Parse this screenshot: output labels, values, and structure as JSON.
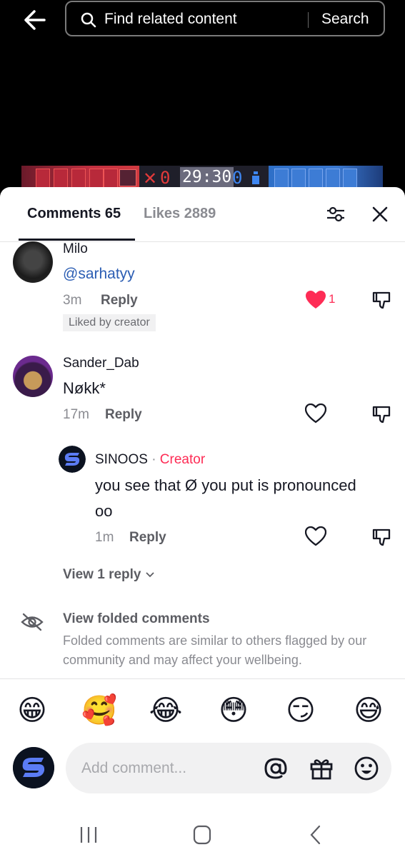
{
  "search": {
    "placeholder": "Find related content",
    "button": "Search"
  },
  "hud": {
    "red_score": "0",
    "timer": "29:30",
    "blue_score": "0"
  },
  "tabs": {
    "comments": "Comments 65",
    "likes": "Likes 2889"
  },
  "comments": [
    {
      "username": "Milo",
      "text": "@sarhatyy",
      "time": "3m",
      "reply": "Reply",
      "likes": "1",
      "liked_by": "Liked by creator"
    },
    {
      "username": "Sander_Dab",
      "text": "Nøkk*",
      "time": "17m",
      "reply": "Reply"
    }
  ],
  "reply": {
    "username": "SINOOS",
    "separator": "·",
    "badge": "Creator",
    "text_line1": "you see that Ø you put is pronounced",
    "text_line2": "oo",
    "time": "1m",
    "reply": "Reply"
  },
  "view_replies": "View 1 reply",
  "folded": {
    "title": "View folded comments",
    "desc": "Folded comments are similar to others flagged by our community and may affect your wellbeing."
  },
  "emojis": [
    "😁",
    "🥰",
    "😂",
    "😳",
    "😏",
    "😅"
  ],
  "comment_input": {
    "placeholder": "Add comment..."
  },
  "colors": {
    "accent": "#fe2c55",
    "mention": "#2b5db3",
    "text": "#161823",
    "muted": "#8a8b91"
  },
  "icons": [
    "back-arrow-icon",
    "search-icon",
    "filter-icon",
    "close-icon",
    "heart-icon",
    "dislike-icon",
    "eye-off-icon",
    "at-icon",
    "gift-icon",
    "emoji-icon",
    "recent-apps-icon",
    "home-icon",
    "back-nav-icon"
  ]
}
